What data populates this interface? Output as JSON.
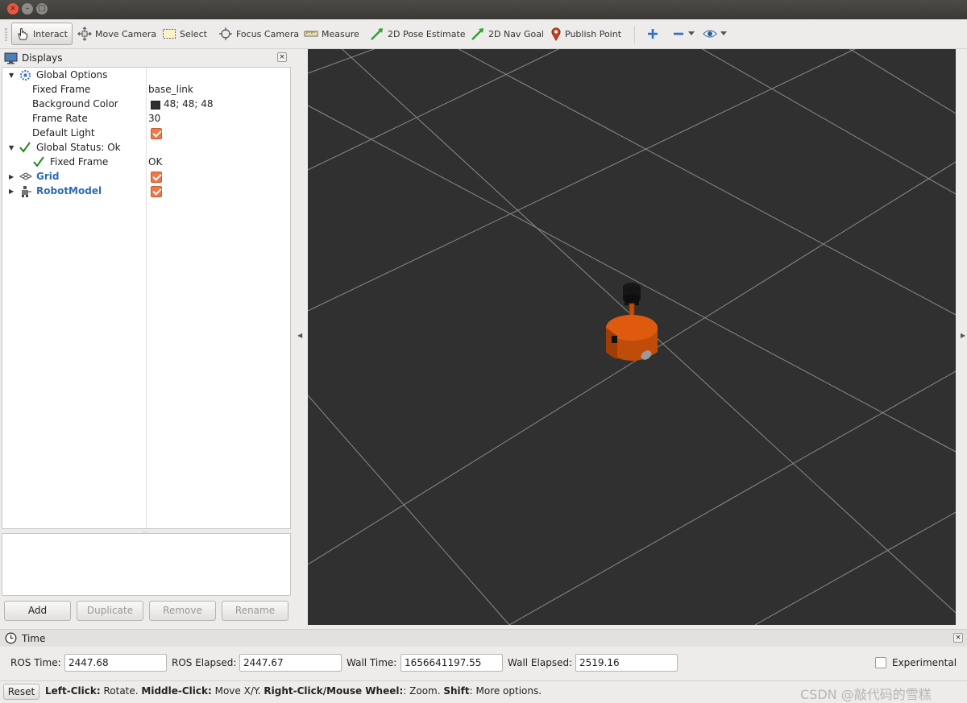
{
  "toolbar": {
    "interact": "Interact",
    "move_camera": "Move Camera",
    "select": "Select",
    "focus_camera": "Focus Camera",
    "measure": "Measure",
    "pose_estimate": "2D Pose Estimate",
    "nav_goal": "2D Nav Goal",
    "publish_point": "Publish Point"
  },
  "displays": {
    "title": "Displays",
    "global_options": {
      "label": "Global Options",
      "fixed_frame_label": "Fixed Frame",
      "fixed_frame_value": "base_link",
      "background_color_label": "Background Color",
      "background_color_value": "48; 48; 48",
      "frame_rate_label": "Frame Rate",
      "frame_rate_value": "30",
      "default_light_label": "Default Light",
      "default_light_checked": true
    },
    "global_status": {
      "label": "Global Status: Ok",
      "fixed_frame_label": "Fixed Frame",
      "fixed_frame_value": "OK"
    },
    "items": [
      {
        "label": "Grid",
        "checked": true
      },
      {
        "label": "RobotModel",
        "checked": true
      }
    ],
    "buttons": {
      "add": "Add",
      "duplicate": "Duplicate",
      "remove": "Remove",
      "rename": "Rename"
    }
  },
  "viewport": {
    "background_color": "#303030",
    "grid_color": "#a0a0a0",
    "robot_color": "#d8560c"
  },
  "time": {
    "title": "Time",
    "ros_time_label": "ROS Time:",
    "ros_time_value": "2447.68",
    "ros_elapsed_label": "ROS Elapsed:",
    "ros_elapsed_value": "2447.67",
    "wall_time_label": "Wall Time:",
    "wall_time_value": "1656641197.55",
    "wall_elapsed_label": "Wall Elapsed:",
    "wall_elapsed_value": "2519.16",
    "experimental_label": "Experimental",
    "experimental_checked": false
  },
  "status": {
    "reset_label": "Reset",
    "hint_left_click": "Left-Click:",
    "hint_rotate": " Rotate. ",
    "hint_middle_click": "Middle-Click:",
    "hint_move": " Move X/Y. ",
    "hint_right_click": "Right-Click/Mouse Wheel:",
    "hint_zoom": ": Zoom. ",
    "hint_shift": "Shift",
    "hint_more": ": More options.",
    "watermark": "CSDN @敲代码的雪糕"
  }
}
